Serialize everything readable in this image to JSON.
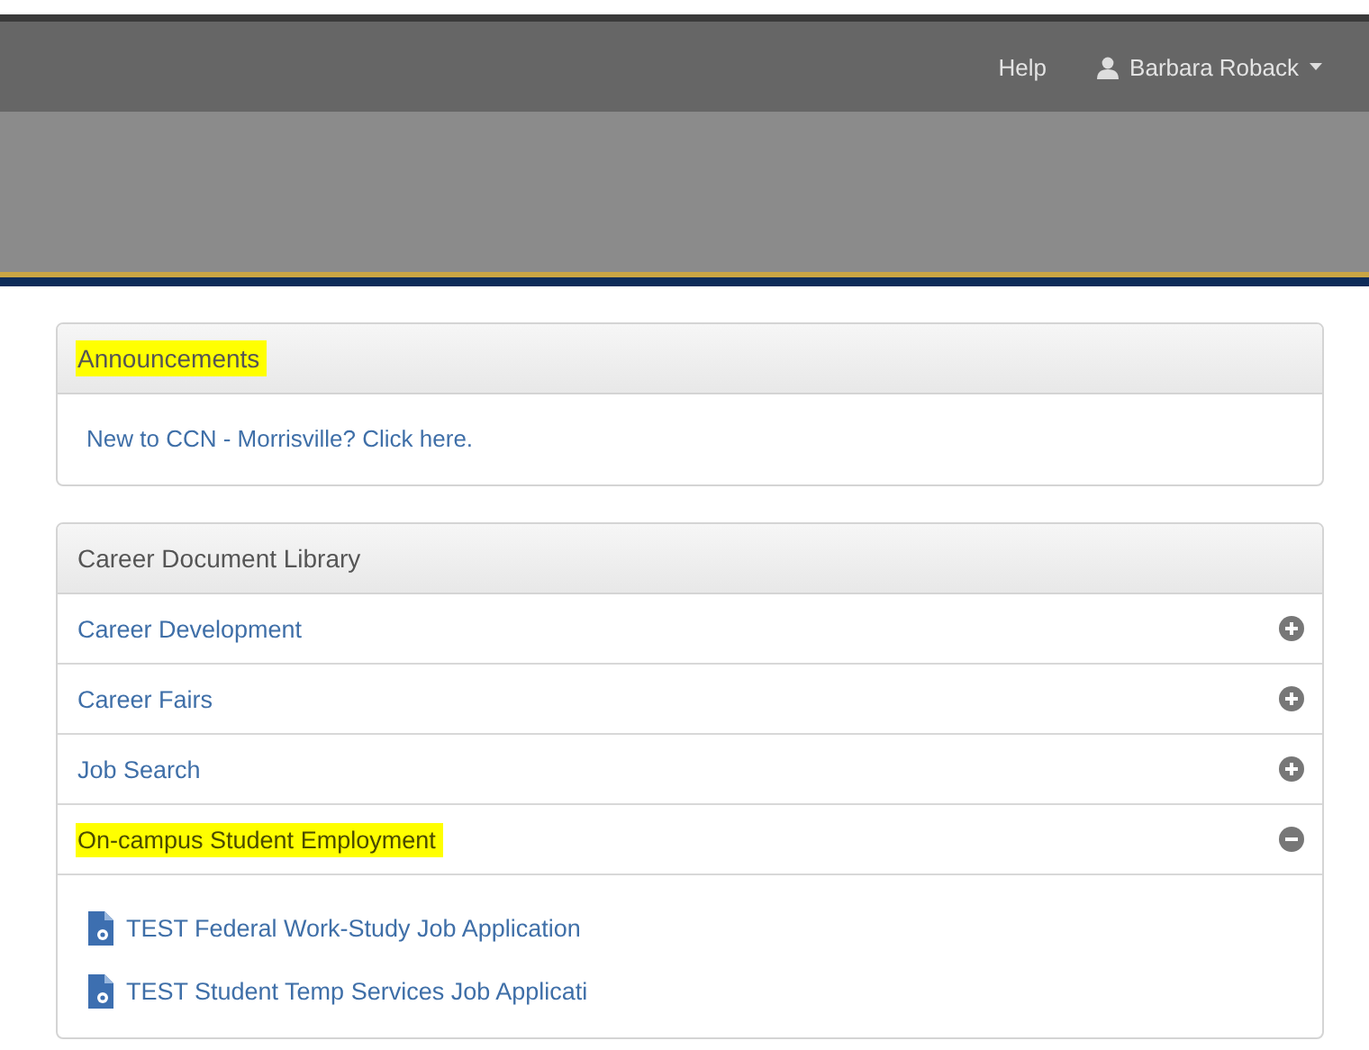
{
  "top_nav": {
    "help": "Help",
    "user": "Barbara Roback"
  },
  "announcements": {
    "title": "Announcements",
    "highlighted": true,
    "items": [
      "New to CCN - Morrisville? Click here."
    ]
  },
  "library": {
    "title": "Career Document Library",
    "categories": [
      {
        "label": "Career Development",
        "expanded": false,
        "highlighted": false
      },
      {
        "label": "Career Fairs",
        "expanded": false,
        "highlighted": false
      },
      {
        "label": "Job Search",
        "expanded": false,
        "highlighted": false
      },
      {
        "label": "On-campus Student Employment",
        "expanded": true,
        "highlighted": true,
        "documents": [
          "TEST Federal Work-Study Job Application",
          "TEST Student Temp Services Job Applicati"
        ]
      }
    ]
  }
}
